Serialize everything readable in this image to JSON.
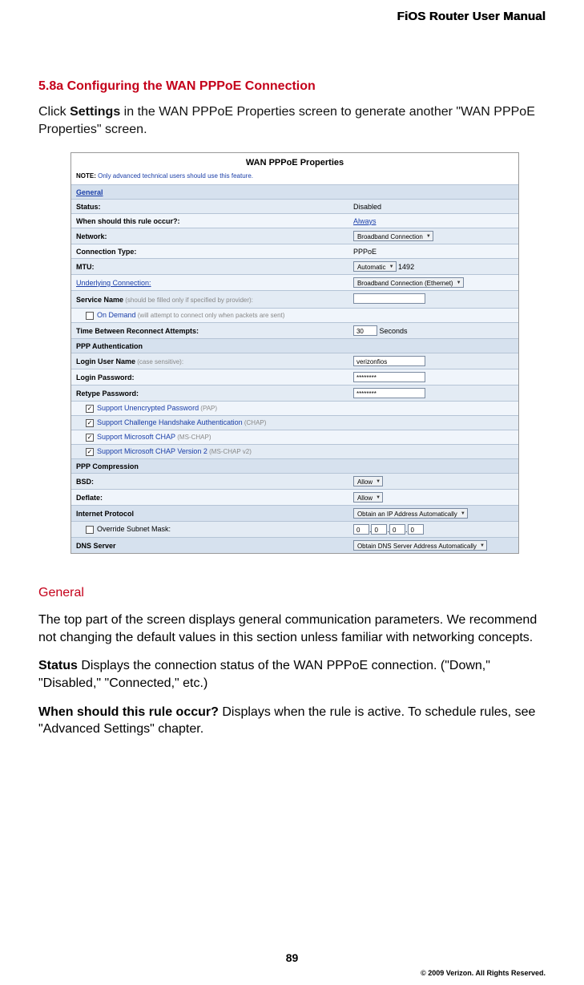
{
  "header": {
    "title": "FiOS Router User Manual"
  },
  "section": {
    "heading": "5.8a  Configuring the WAN PPPoE Connection",
    "intro_pre": "Click ",
    "intro_bold": "Settings",
    "intro_post": " in the WAN PPPoE Properties screen to generate another \"WAN PPPoE Properties\" screen."
  },
  "screenshot": {
    "title": "WAN PPPoE Properties",
    "note_label": "NOTE:",
    "note_text": " Only advanced technical users should use this feature.",
    "rows": {
      "general_header": "General",
      "status_label": "Status:",
      "status_value": "Disabled",
      "rule_label": "When should this rule occur?:",
      "rule_value": "Always",
      "network_label": "Network:",
      "network_select": "Broadband Connection",
      "ctype_label": "Connection Type:",
      "ctype_value": "PPPoE",
      "mtu_label": "MTU:",
      "mtu_select": "Automatic",
      "mtu_num": "1492",
      "underlying_label": "Underlying Connection:",
      "underlying_select": "Broadband Connection (Ethernet)",
      "svcname_label_b": "Service Name",
      "svcname_label_g": " (should be filled only if specified by provider):",
      "svcname_value": "",
      "ondemand_label": "On Demand",
      "ondemand_gray": " (will attempt to connect only when packets are sent)",
      "reconnect_label": "Time Between Reconnect Attempts:",
      "reconnect_value": "30",
      "reconnect_unit": "Seconds",
      "pppauth_header": "PPP Authentication",
      "login_label_b": "Login User Name",
      "login_label_g": " (case sensitive):",
      "login_value": "verizonfios",
      "pw_label": "Login Password:",
      "pw_value": "********",
      "rpw_label": "Retype Password:",
      "rpw_value": "********",
      "pap_label": "Support Unencrypted Password",
      "pap_g": " (PAP)",
      "chap_label": "Support Challenge Handshake Authentication",
      "chap_g": " (CHAP)",
      "mschap_label": "Support Microsoft CHAP",
      "mschap_g": " (MS-CHAP)",
      "mschap2_label": "Support Microsoft CHAP Version 2",
      "mschap2_g": " (MS-CHAP v2)",
      "pppcomp_header": "PPP Compression",
      "bsd_label": "BSD:",
      "bsd_select": "Allow",
      "deflate_label": "Deflate:",
      "deflate_select": "Allow",
      "ip_header": "Internet Protocol",
      "ip_select": "Obtain an IP Address Automatically",
      "osm_label": "Override Subnet Mask:",
      "osm_oct": "0",
      "dns_header": "DNS Server",
      "dns_select": "Obtain DNS Server Address Automatically"
    }
  },
  "body": {
    "general_heading": "General",
    "general_para": "The top part of the screen displays general communication parameters. We recommend not changing the default values in this section unless familiar with networking concepts.",
    "status_b": "Status",
    "status_text": "  Displays the connection status of the WAN PPPoE connection. (\"Down,\" \"Disabled,\" \"Connected,\" etc.)",
    "rule_b": "When should this rule occur?",
    "rule_text": "  Displays when the rule is active. To schedule rules, see \"Advanced Settings\" chapter."
  },
  "footer": {
    "page": "89",
    "copyright": "© 2009 Verizon. All Rights Reserved."
  }
}
